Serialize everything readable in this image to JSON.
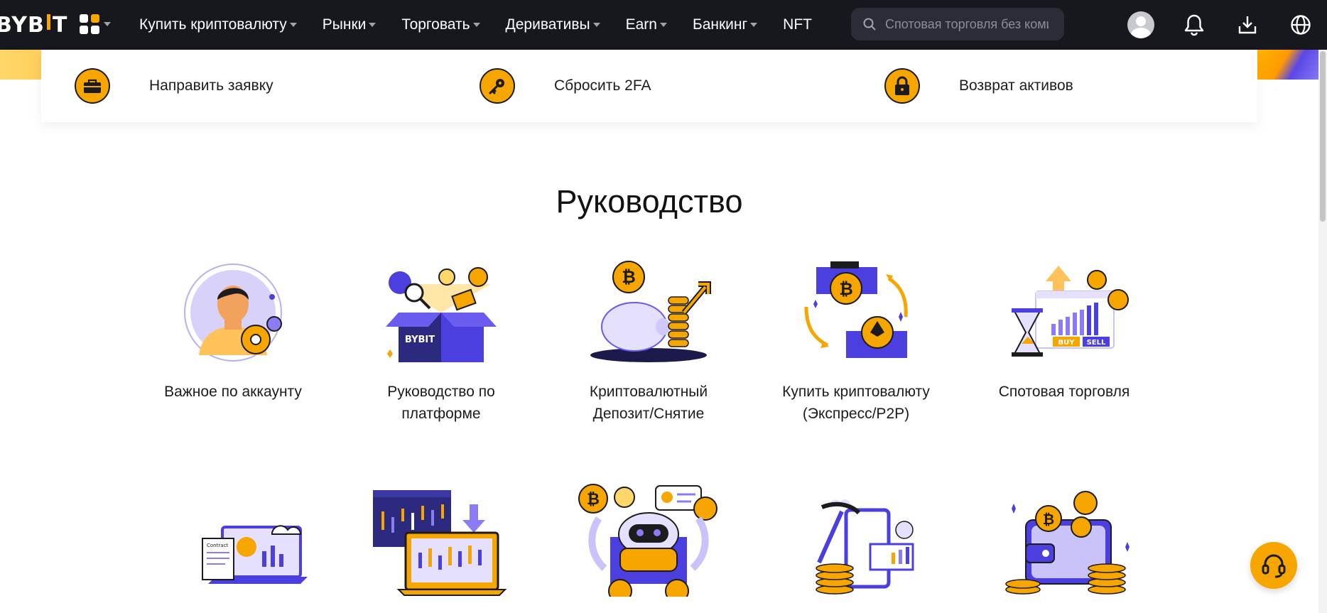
{
  "header": {
    "logo_text_a": "BYB",
    "logo_text_b": "T",
    "nav": [
      {
        "label": "Купить криптовалюту",
        "has_caret": true
      },
      {
        "label": "Рынки",
        "has_caret": true
      },
      {
        "label": "Торговать",
        "has_caret": true
      },
      {
        "label": "Деривативы",
        "has_caret": true
      },
      {
        "label": "Earn",
        "has_caret": true
      },
      {
        "label": "Банкинг",
        "has_caret": true
      },
      {
        "label": "NFT",
        "has_caret": false
      }
    ],
    "search_placeholder": "Спотовая торговля без комиссий"
  },
  "quick_links": [
    {
      "label": "Направить заявку",
      "icon": "briefcase-icon"
    },
    {
      "label": "Сбросить 2FA",
      "icon": "key-icon"
    },
    {
      "label": "Возврат активов",
      "icon": "lock-icon"
    }
  ],
  "guide": {
    "title": "Руководство",
    "cards": [
      {
        "label": "Важное по аккаунту"
      },
      {
        "label": "Руководство по платформе"
      },
      {
        "label": "Криптовалютный Депозит/Снятие"
      },
      {
        "label": "Купить криптовалюту (Экспресс/P2P)"
      },
      {
        "label": "Спотовая торговля"
      },
      {
        "label": ""
      },
      {
        "label": ""
      },
      {
        "label": ""
      },
      {
        "label": ""
      },
      {
        "label": ""
      }
    ],
    "illustration_text": {
      "box_brand": "BYBIT",
      "buy": "BUY",
      "sell": "SELL",
      "contract": "Contract"
    }
  },
  "colors": {
    "accent": "#f7a600",
    "purple": "#4b3fe0",
    "topbar": "#17181e"
  }
}
